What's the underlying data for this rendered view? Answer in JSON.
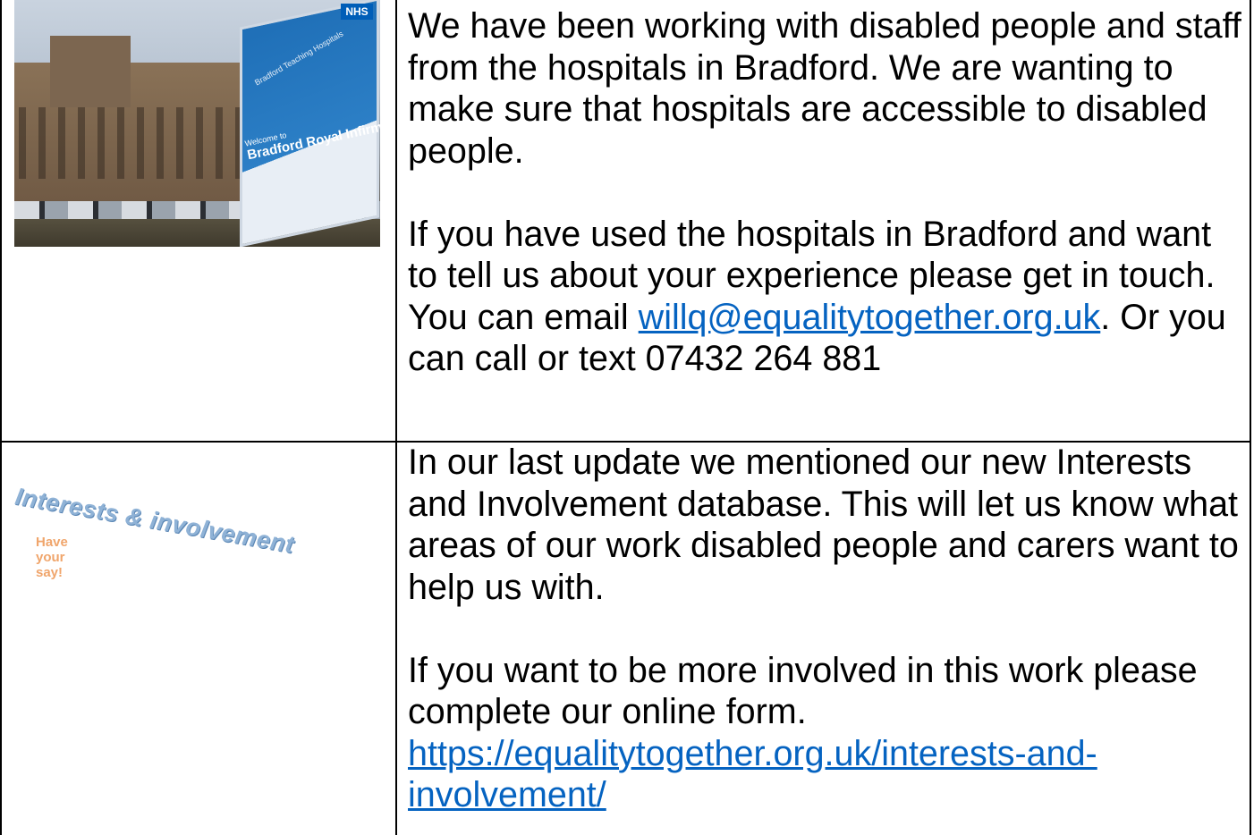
{
  "rows": [
    {
      "image": {
        "icon": "hospital-photo",
        "sign_org": "Bradford Teaching Hospitals",
        "sign_badge": "NHS",
        "sign_name": "Bradford Royal Infirmary",
        "sign_welcome": "Welcome to"
      },
      "paragraph1": "We have been working with disabled people and staff from the hospitals in Bradford. We are wanting to make sure that hospitals are accessible to disabled people.",
      "paragraph2_before": "If you have used the hospitals in Bradford and want to tell us about your experience please get in touch. You can email ",
      "email": "willq@equalitytogether.org.uk",
      "paragraph2_after": ". Or you can call or text 07432 264 881"
    },
    {
      "image": {
        "icon": "interests-involvement-logo",
        "title": "Interests & involvement",
        "subtitle": "Have your say!"
      },
      "paragraph1": "In our last update we mentioned our new Interests and Involvement database. This will let us know what areas of our work disabled people and carers want to help us with.",
      "paragraph2": "If you want to be more involved in this work please complete our online form.",
      "link": "https://equalitytogether.org.uk/interests-and-involvement/"
    }
  ],
  "colors": {
    "link": "#0563c1",
    "logo_title": "#8fb2d6",
    "logo_subtitle": "#f0a56b"
  }
}
